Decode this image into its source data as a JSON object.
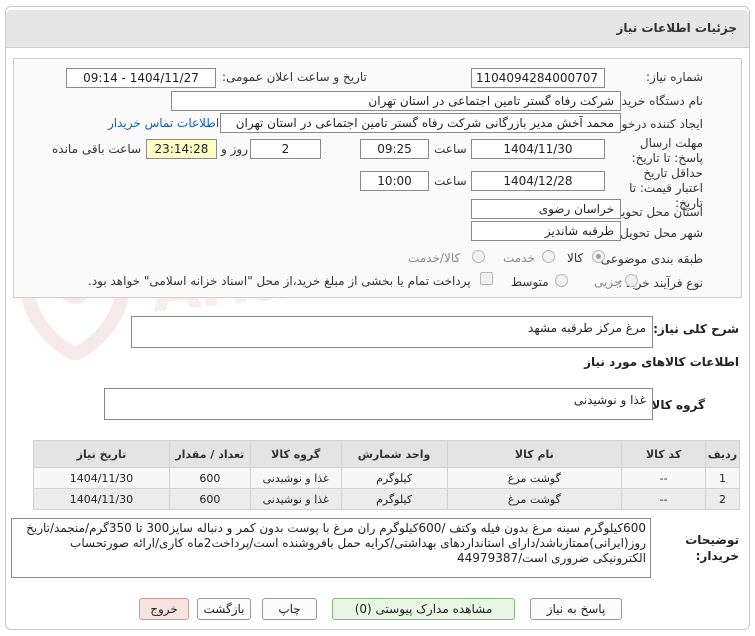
{
  "header": {
    "title": "جزئیات اطلاعات نیاز"
  },
  "watermark": "AriaTender.net",
  "fields": {
    "need_number_label": "شماره نیاز:",
    "need_number": "1104094284000707",
    "announce_label": "تاریخ و ساعت اعلان عمومی:",
    "announce_value": "1404/11/27 - 09:14",
    "buyer_org_label": "نام دستگاه خریدار:",
    "buyer_org": "شرکت رفاه گستر تامین اجتماعی در استان تهران",
    "creator_label": "ایجاد کننده درخواست:",
    "creator": "محمد آخش مدیر بازرگانی شرکت رفاه گستر تامین اجتماعی در استان تهران",
    "buyer_contact_link": "اطلاعات تماس خریدار",
    "reply_deadline_label": "مهلت ارسال پاسخ: تا تاریخ:",
    "reply_date": "1404/11/30",
    "time_label": "ساعت",
    "reply_time": "09:25",
    "days_value": "2",
    "days_label": "روز و",
    "remaining_time": "23:14:28",
    "remaining_label": "ساعت باقی مانده",
    "min_validity_label": "حداقل تاریخ اعتبار قیمت: تا تاریخ:",
    "validity_date": "1404/12/28",
    "validity_time": "10:00",
    "province_label": "استان محل تحویل:",
    "province": "خراسان رضوی",
    "city_label": "شهر محل تحویل:",
    "city": "طرقبه شاندیز",
    "category_label": "طبقه بندی موضوعی:",
    "category_options": [
      "کالا",
      "خدمت",
      "کالا/خدمت"
    ],
    "category_selected": "کالا",
    "process_label": "نوع فرآیند خرید :",
    "process_options": [
      "جزیی",
      "متوسط"
    ],
    "process_note": "پرداخت تمام یا بخشی از مبلغ خرید،از محل \"اسناد خزانه اسلامی\" خواهد بود."
  },
  "summary": {
    "label": "شرح کلی نیاز:",
    "value": "مرغ مرکز طرقبه مشهد"
  },
  "goods_info": {
    "title": "اطلاعات کالاهای مورد نیاز",
    "group_label": "گروه کالا:",
    "group_value": "غذا و نوشیدنی"
  },
  "table": {
    "headers": [
      "ردیف",
      "کد کالا",
      "نام کالا",
      "واحد شمارش",
      "گروه کالا",
      "تعداد / مقدار",
      "تاریخ نیاز"
    ],
    "rows": [
      [
        "1",
        "--",
        "گوشت مرغ",
        "کیلوگرم",
        "غذا و نوشیدنی",
        "600",
        "1404/11/30"
      ],
      [
        "2",
        "--",
        "گوشت مرغ",
        "کیلوگرم",
        "غذا و نوشیدنی",
        "600",
        "1404/11/30"
      ]
    ]
  },
  "buyer_notes": {
    "label": "توضیحات خریدار:",
    "value": "600کیلوگرم سینه مرغ بدون فیله وکتف /600کیلوگرم ران مرغ با پوست بدون کمر و دنباله سایز300 تا 350گرم/منجمد/تاریخ روز(ایرانی)ممتازباشد/دارای استانداردهای بهداشتی/کرایه حمل بافروشنده است/پرداخت2ماه کاری/ارائه صورتحساب الکترونیکی ضروری است/44979387"
  },
  "buttons": {
    "reply": "پاسخ به نیاز",
    "attachments": "مشاهده مدارک پیوستی (0)",
    "print": "چاپ",
    "back": "بازگشت",
    "exit": "خروج"
  },
  "colors": {
    "accent_link": "#1a5fb4",
    "highlight": "#ffffc4"
  }
}
